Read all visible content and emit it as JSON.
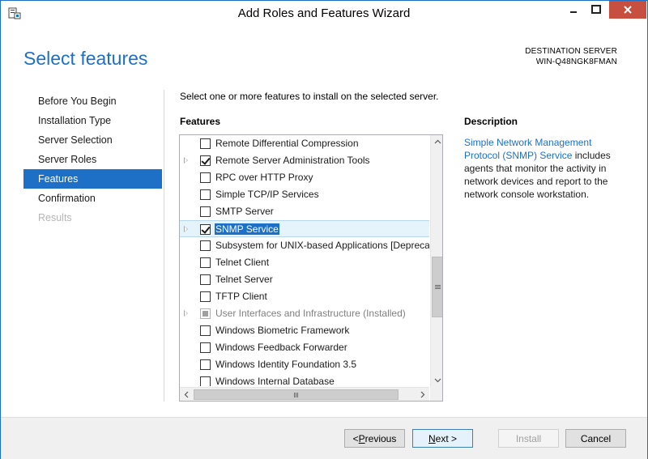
{
  "window": {
    "title": "Add Roles and Features Wizard"
  },
  "header": {
    "page_title": "Select features",
    "destination_label": "DESTINATION SERVER",
    "destination_server": "WIN-Q48NGK8FMAN"
  },
  "nav": {
    "items": [
      {
        "label": "Before You Begin",
        "state": "normal"
      },
      {
        "label": "Installation Type",
        "state": "normal"
      },
      {
        "label": "Server Selection",
        "state": "normal"
      },
      {
        "label": "Server Roles",
        "state": "normal"
      },
      {
        "label": "Features",
        "state": "active"
      },
      {
        "label": "Confirmation",
        "state": "normal"
      },
      {
        "label": "Results",
        "state": "disabled"
      }
    ]
  },
  "main": {
    "instruction": "Select one or more features to install on the selected server.",
    "features_label": "Features",
    "features": [
      {
        "label": "Remote Differential Compression",
        "checked": "unchecked",
        "expandable": false
      },
      {
        "label": "Remote Server Administration Tools",
        "checked": "checked",
        "expandable": true
      },
      {
        "label": "RPC over HTTP Proxy",
        "checked": "unchecked",
        "expandable": false
      },
      {
        "label": "Simple TCP/IP Services",
        "checked": "unchecked",
        "expandable": false
      },
      {
        "label": "SMTP Server",
        "checked": "unchecked",
        "expandable": false
      },
      {
        "label": "SNMP Service",
        "checked": "checked",
        "expandable": true,
        "selected": true
      },
      {
        "label": "Subsystem for UNIX-based Applications [Deprecated]",
        "checked": "unchecked",
        "expandable": false
      },
      {
        "label": "Telnet Client",
        "checked": "unchecked",
        "expandable": false
      },
      {
        "label": "Telnet Server",
        "checked": "unchecked",
        "expandable": false
      },
      {
        "label": "TFTP Client",
        "checked": "unchecked",
        "expandable": false
      },
      {
        "label": "User Interfaces and Infrastructure (Installed)",
        "checked": "partial",
        "expandable": true,
        "dim": true
      },
      {
        "label": "Windows Biometric Framework",
        "checked": "unchecked",
        "expandable": false
      },
      {
        "label": "Windows Feedback Forwarder",
        "checked": "unchecked",
        "expandable": false
      },
      {
        "label": "Windows Identity Foundation 3.5",
        "checked": "unchecked",
        "expandable": false
      },
      {
        "label": "Windows Internal Database",
        "checked": "unchecked",
        "expandable": false
      }
    ]
  },
  "description": {
    "label": "Description",
    "link_text": "Simple Network Management Protocol (SNMP) Service",
    "body": " includes agents that monitor the activity in network devices and report to the network console workstation."
  },
  "footer": {
    "previous_label": "< Previous",
    "next_label": "Next >",
    "install_label": "Install",
    "cancel_label": "Cancel"
  },
  "colors": {
    "accent": "#1e6fc6",
    "close_button": "#c74f3f"
  }
}
